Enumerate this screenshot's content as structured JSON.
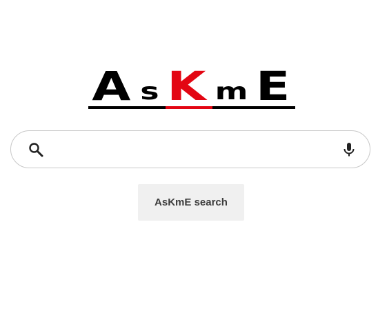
{
  "logo": {
    "letters": [
      "A",
      "s",
      "K",
      "m",
      "E"
    ],
    "accent_color": "#e30613",
    "text_color": "#000000"
  },
  "search": {
    "value": "",
    "placeholder": "",
    "search_icon": "search-icon",
    "mic_icon": "microphone-icon"
  },
  "button": {
    "label": "AsKmE search"
  }
}
